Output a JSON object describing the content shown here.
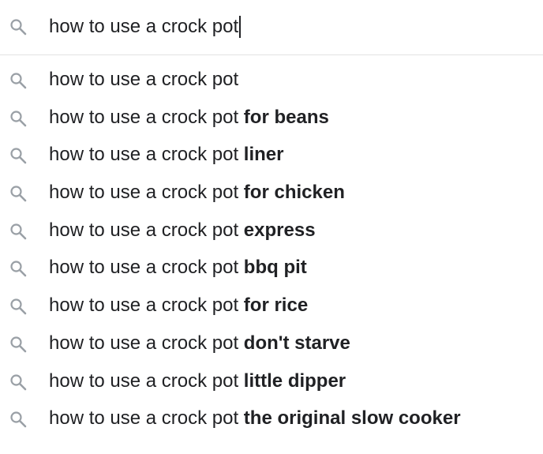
{
  "search": {
    "query": "how to use a crock pot",
    "icon": "search-icon"
  },
  "colors": {
    "icon": "#9aa0a6",
    "text": "#202124",
    "divider": "#e3e3e3"
  },
  "suggestions": [
    {
      "prefix": "how to use a crock pot",
      "completion": ""
    },
    {
      "prefix": "how to use a crock pot",
      "completion": "for beans"
    },
    {
      "prefix": "how to use a crock pot",
      "completion": "liner"
    },
    {
      "prefix": "how to use a crock pot",
      "completion": "for chicken"
    },
    {
      "prefix": "how to use a crock pot",
      "completion": "express"
    },
    {
      "prefix": "how to use a crock pot",
      "completion": "bbq pit"
    },
    {
      "prefix": "how to use a crock pot",
      "completion": "for rice"
    },
    {
      "prefix": "how to use a crock pot",
      "completion": "don't starve"
    },
    {
      "prefix": "how to use a crock pot",
      "completion": "little dipper"
    },
    {
      "prefix": "how to use a crock pot",
      "completion": "the original slow cooker"
    }
  ]
}
